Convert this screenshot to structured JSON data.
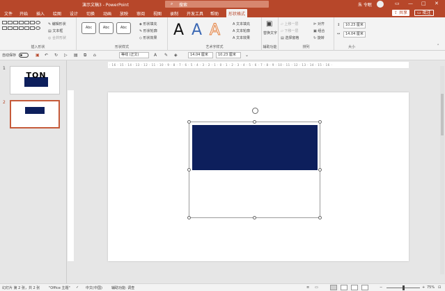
{
  "titlebar": {
    "title": "演示文稿3 - PowerPoint",
    "search_placeholder": "搜索",
    "user": "朱 令眠",
    "btn_min": "—",
    "btn_restore": "□",
    "btn_close": "✕"
  },
  "menu": {
    "tabs": [
      "文件",
      "开始",
      "插入",
      "绘图",
      "设计",
      "切换",
      "动画",
      "放映",
      "审阅",
      "视图",
      "录制",
      "开发工具",
      "帮助",
      "形状格式"
    ],
    "active": "形状格式",
    "share": "共享",
    "comment": "批注"
  },
  "ribbon": {
    "insert_shapes": {
      "label": "插入形状",
      "edit_shape": "编辑形状",
      "text_box": "文本框",
      "merge_shapes": "合并形状"
    },
    "shape_styles": {
      "label": "形状样式",
      "style_texts": [
        "Abc",
        "Abc",
        "Abc"
      ],
      "fill": "形状填充",
      "outline": "形状轮廓",
      "effects": "形状效果"
    },
    "wordart": {
      "label": "艺术字样式",
      "letters": [
        "A",
        "A",
        "A"
      ],
      "text_fill": "文本填充",
      "text_outline": "文本轮廓",
      "text_effects": "文本效果"
    },
    "accessibility": {
      "label": "辅助功能",
      "alt_text": "替换文字"
    },
    "arrange": {
      "label": "排列",
      "bring_forward": "上移一层",
      "send_backward": "下移一层",
      "selection_pane": "选择窗格",
      "align": "对齐",
      "group": "组合",
      "rotate": "旋转"
    },
    "size": {
      "label": "大小",
      "height": "10.23 厘米",
      "width": "14.04 厘米"
    }
  },
  "qat": {
    "autosave": "自动保存",
    "font": "等线 (正文)",
    "height": "14.04 厘米",
    "width": "10.23 厘米"
  },
  "thumbs": {
    "slide1_num": "1",
    "slide1_text": "TON",
    "slide2_num": "2"
  },
  "ruler": {
    "marks": "· 16 · 15 · 14 · 13 · 12 · 11 · 10 · 9 · 8 · 7 · 6 · 5 · 4 · 3 · 2 · 1 · 0 · 1 · 2 · 3 · 4 · 5 · 6 · 7 · 8 · 9 · 10 · 11 · 12 · 13 · 14 · 15 · 16 ·"
  },
  "status": {
    "slide_info": "幻灯片 第 2 张，共 2 张",
    "theme": "\"Office 主题\"",
    "language": "中文(中国)",
    "accessibility": "辅助功能: 调查",
    "zoom": "75%"
  },
  "colors": {
    "accent": "#b7472a",
    "shape_fill": "#0d1f5c"
  }
}
